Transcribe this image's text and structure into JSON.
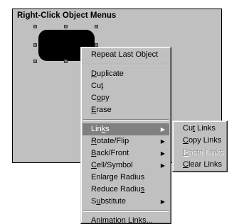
{
  "panel": {
    "title": "Right-Click Object Menus"
  },
  "main_menu": {
    "items": [
      {
        "pre": "",
        "u": "",
        "post": "Repeat Last Object"
      },
      {
        "pre": "",
        "u": "D",
        "post": "uplicate"
      },
      {
        "pre": "Cu",
        "u": "t",
        "post": ""
      },
      {
        "pre": "C",
        "u": "o",
        "post": "py"
      },
      {
        "pre": "",
        "u": "E",
        "post": "rase"
      },
      {
        "pre": "Lin",
        "u": "k",
        "post": "s"
      },
      {
        "pre": "",
        "u": "R",
        "post": "otate/Flip"
      },
      {
        "pre": "",
        "u": "B",
        "post": "ack/Front"
      },
      {
        "pre": "",
        "u": "C",
        "post": "ell/Symbol"
      },
      {
        "pre": "Enlarge Radius",
        "u": "",
        "post": ""
      },
      {
        "pre": "Reduce Radiu",
        "u": "s",
        "post": ""
      },
      {
        "pre": "S",
        "u": "u",
        "post": "bstitute"
      },
      {
        "pre": "",
        "u": "A",
        "post": "nimation Links..."
      }
    ],
    "arrow": "▶"
  },
  "links_submenu": {
    "items": [
      {
        "pre": "Cu",
        "u": "t",
        "post": " Links"
      },
      {
        "pre": "",
        "u": "C",
        "post": "opy Links"
      },
      {
        "pre": "",
        "u": "P",
        "post": "aste Links"
      },
      {
        "pre": "",
        "u": "C",
        "post": "lear Links"
      }
    ]
  }
}
